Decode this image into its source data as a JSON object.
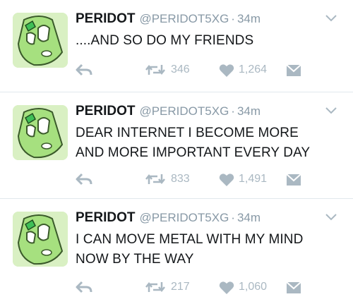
{
  "colors": {
    "name": "#14171a",
    "meta": "#8899a6",
    "action": "#aab8c2",
    "divider": "#e1e8ed",
    "avatar_bg": "#d9f0c3",
    "gem": "#3fbf57"
  },
  "icons": {
    "reply": "reply-icon",
    "retweet": "retweet-icon",
    "like": "heart-icon",
    "message": "direct-message-icon",
    "menu": "chevron-down-icon"
  },
  "tweets": [
    {
      "name": "PERIDOT",
      "handle": "@PERIDOT5XG",
      "sep": "·",
      "time": "34m",
      "lines": [
        "....AND SO DO MY FRIENDS"
      ],
      "retweets": "346",
      "likes": "1,264"
    },
    {
      "name": "PERIDOT",
      "handle": "@PERIDOT5XG",
      "sep": "·",
      "time": "34m",
      "lines": [
        "DEAR INTERNET I BECOME MORE",
        "AND MORE IMPORTANT EVERY DAY"
      ],
      "retweets": "833",
      "likes": "1,491"
    },
    {
      "name": "PERIDOT",
      "handle": "@PERIDOT5XG",
      "sep": "·",
      "time": "34m",
      "lines": [
        "I CAN MOVE METAL WITH MY MIND",
        "NOW BY THE WAY"
      ],
      "retweets": "217",
      "likes": "1,060"
    }
  ]
}
